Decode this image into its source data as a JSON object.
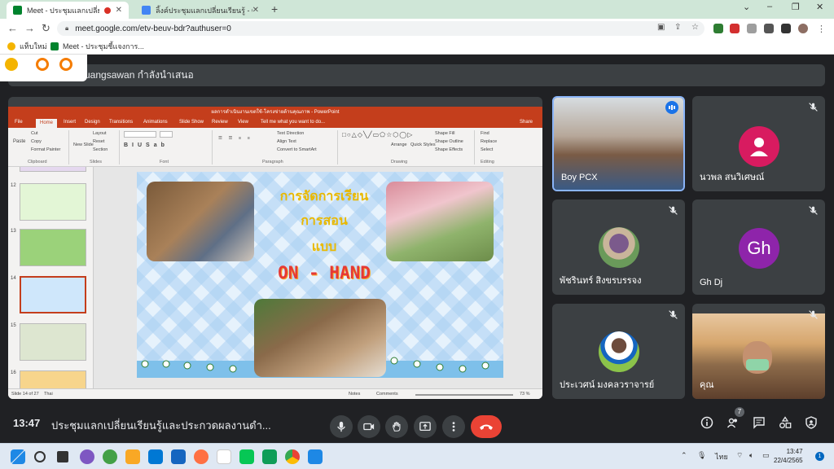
{
  "browser": {
    "tabs": [
      {
        "title": "Meet - ประชุมแลกเปลี่ยนเรียนรู้...",
        "active": true,
        "favicon_color": "#00832d"
      },
      {
        "title": "ลิ้งค์ประชุมแลกเปลี่ยนเรียนรู้ - Google...",
        "active": false,
        "favicon_color": "#4285f4"
      }
    ],
    "new_tab": "+",
    "window_controls": {
      "chevron": "⌄",
      "minimize": "–",
      "maximize": "❐",
      "close": "✕"
    },
    "url": "meet.google.com/etv-beuv-bdr?authuser=0",
    "bookmarks": [
      {
        "label": "แท็บใหม่"
      },
      {
        "label": "Meet - ประชุมชี้แจงการ..."
      }
    ]
  },
  "meet": {
    "presenter_banner": "uangsawan กำลังนำเสนอ",
    "clock": "13:47",
    "meeting_title": "ประชุมแลกเปลี่ยนเรียนรู้และประกวดผลงานดำ...",
    "people_count": "7",
    "accent_end_call": "#ea4335",
    "participants": [
      {
        "name": "Boy PCX",
        "type": "video",
        "speaking": true
      },
      {
        "name": "นวพล สนวิเศษณ์",
        "type": "avatar-icon",
        "color": "#d81b60",
        "muted": true
      },
      {
        "name": "พัชรินทร์ สิงขรบรรจง",
        "type": "photo",
        "muted": true
      },
      {
        "name": "Gh Dj",
        "type": "letter",
        "letter": "Gh",
        "color": "#8e24aa",
        "muted": true
      },
      {
        "name": "ประเวศน์ มงคลวราจารย์",
        "type": "photo",
        "muted": true
      },
      {
        "name": "คุณ",
        "type": "video",
        "muted": true
      }
    ]
  },
  "powerpoint": {
    "window_title": "ผลการดำเนินงานเขตใช้-โครงข่ายด้านคุณภาพ - PowerPoint",
    "tabs": [
      "File",
      "Home",
      "Insert",
      "Design",
      "Transitions",
      "Animations",
      "Slide Show",
      "Review",
      "View",
      "Tell me what you want to do..."
    ],
    "share": "Share",
    "ribbon": {
      "paste": "Paste",
      "cut": "Cut",
      "copy": "Copy",
      "format_painter": "Format Painter",
      "new_slide": "New Slide",
      "layout": "Layout",
      "reset": "Reset",
      "section": "Section",
      "text_direction": "Text Direction",
      "align_text": "Align Text",
      "convert_smartart": "Convert to SmartArt",
      "arrange": "Arrange",
      "quick_styles": "Quick Styles",
      "shape_fill": "Shape Fill",
      "shape_outline": "Shape Outline",
      "shape_effects": "Shape Effects",
      "find": "Find",
      "replace": "Replace",
      "select": "Select",
      "groups": [
        "Clipboard",
        "Slides",
        "Font",
        "Paragraph",
        "Drawing",
        "Editing"
      ]
    },
    "thumbnail_numbers": [
      "12",
      "13",
      "14",
      "15",
      "16"
    ],
    "selected_slide": "14",
    "slide": {
      "line1": "การจัดการเรียน",
      "line2": "การสอน",
      "line3": "แบบ",
      "line4": "ON - HAND"
    },
    "status": {
      "slide_info": "Slide 14 of 27",
      "language": "Thai",
      "notes": "Notes",
      "comments": "Comments",
      "zoom": "73 %"
    }
  },
  "taskbar": {
    "tray_lang": "ไทย",
    "time": "13:47",
    "date": "22/4/2565",
    "notifications": "1"
  }
}
